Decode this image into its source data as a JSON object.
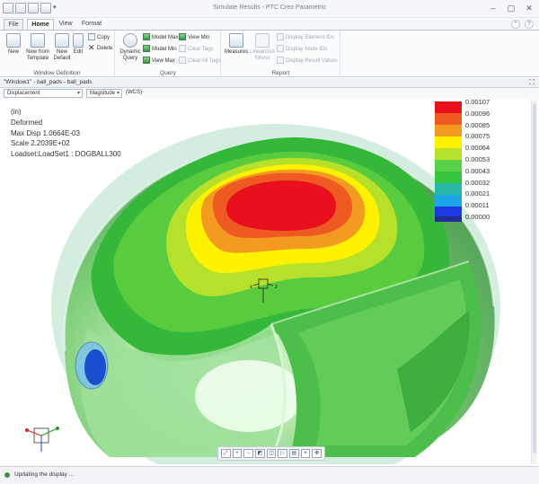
{
  "window": {
    "title": "Simulate Results - PTC Creo Parametric"
  },
  "tabs": {
    "file": "File",
    "home": "Home",
    "view": "View",
    "format": "Format"
  },
  "ribbon": {
    "window_definition": {
      "label": "Window Definition",
      "new": "New",
      "new_from_template_1": "New from",
      "new_from_template_2": "Template",
      "new_default_1": "New",
      "new_default_2": "Default",
      "edit": "Edit",
      "copy": "Copy",
      "delete": "Delete"
    },
    "query": {
      "label": "Query",
      "dynamic_query_1": "Dynamic",
      "dynamic_query_2": "Query",
      "model_max": "Model Max",
      "model_min": "Model Min",
      "view_max": "View Max",
      "view_min": "View Min",
      "clear_tags": "Clear Tags",
      "clear_all_tags": "Clear All Tags"
    },
    "report": {
      "label": "Report",
      "measures": "Measures",
      "linearized_stress_1": "Linearized",
      "linearized_stress_2": "Stress",
      "display_element_ids": "Display Element IDs",
      "display_node_ids": "Display Node IDs",
      "display_result_values": "Display Result Values"
    }
  },
  "result_window": {
    "title": "\"Window1\" - ball_pads - ball_pads",
    "quantity_select": "Displacement",
    "component_select": "Magnitude",
    "coord_system": "(WCS)"
  },
  "result_info": {
    "units": "(in)",
    "mode": "Deformed",
    "max_disp": "Max Disp  1.0664E-03",
    "scale": "Scale  2.2039E+02",
    "loadset": "Loadset:LoadSet1 : DOGBALL300"
  },
  "legend": {
    "labels": [
      "0.00107",
      "0.00096",
      "0.00085",
      "0.00075",
      "0.00064",
      "0.00053",
      "0.00043",
      "0.00032",
      "0.00021",
      "0.00011",
      "0.00000"
    ],
    "colors": [
      "#e8101c",
      "#ef5a22",
      "#f39a21",
      "#fff200",
      "#b7e02b",
      "#58d147",
      "#35c43d",
      "#27b7a4",
      "#1aa6e8",
      "#1a3be0",
      "#232a96"
    ]
  },
  "status": {
    "message": "Updating the display ..."
  }
}
